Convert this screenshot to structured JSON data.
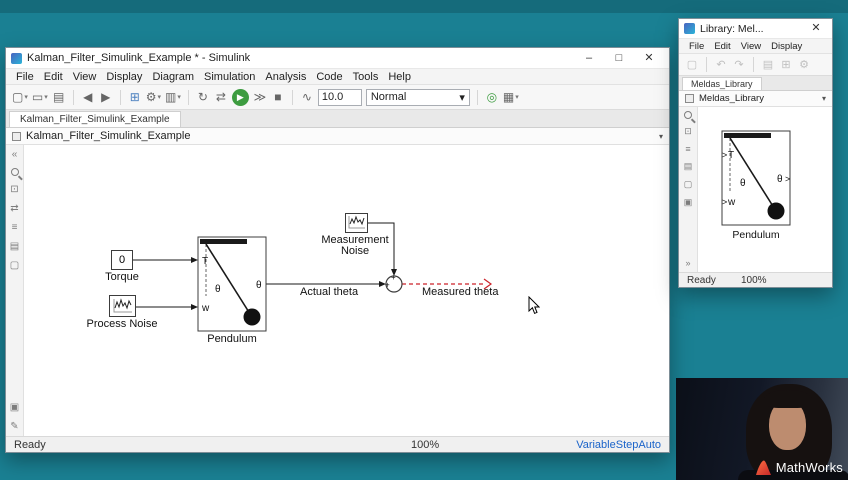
{
  "icons": {
    "caret_down": "▾",
    "new_model": "▢",
    "open": "▭",
    "save": "▤",
    "back": "◀",
    "forward": "▶",
    "library_browser": "⊞",
    "settings": "⚙",
    "model_settings": "▥",
    "refresh": "↻",
    "compare": "⇄",
    "run": "▶",
    "step_forward": "≫",
    "stop": "■",
    "scope": "∿",
    "check": "◎",
    "build": "▦",
    "minimize": "–",
    "maximize": "□",
    "close": "✕",
    "collapse": "«",
    "expand": "»",
    "fit_view": "⊡",
    "list": "≡",
    "layers": "▤",
    "blank": "▢",
    "edit": "✎",
    "frame": "▣",
    "undo": "↶",
    "redo": "↷"
  },
  "main_window": {
    "title": "Kalman_Filter_Simulink_Example * - Simulink",
    "menus": [
      "File",
      "Edit",
      "View",
      "Display",
      "Diagram",
      "Simulation",
      "Analysis",
      "Code",
      "Tools",
      "Help"
    ],
    "toolbar": {
      "sim_stop_time": "10.0",
      "sim_mode": "Normal"
    },
    "tab_label": "Kalman_Filter_Simulink_Example",
    "breadcrumb": "Kalman_Filter_Simulink_Example",
    "status": {
      "left": "Ready",
      "zoom": "100%",
      "solver": "VariableStepAuto"
    },
    "canvas": {
      "torque_value": "0",
      "torque_label": "Torque",
      "process_noise_label": "Process Noise",
      "pendulum_label": "Pendulum",
      "port_T": "T",
      "port_w": "w",
      "port_theta": "θ",
      "theta_symbol": "θ",
      "measurement_noise_label1": "Measurement",
      "measurement_noise_label2": "Noise",
      "sum_plus": "+",
      "actual_theta_label": "Actual theta",
      "measured_theta_label": "Measured theta"
    }
  },
  "library_window": {
    "title": "Library: Mel...",
    "menus": [
      "File",
      "Edit",
      "View",
      "Display"
    ],
    "tab_label": "Meldas_Library",
    "breadcrumb": "Meldas_Library",
    "status": {
      "left": "Ready",
      "zoom": "100%"
    },
    "canvas": {
      "pendulum_label": "Pendulum",
      "port_T": "T",
      "port_w": "w",
      "port_theta": "θ",
      "theta_symbol": "θ",
      "chevron": ">"
    }
  },
  "branding": {
    "logo_text": "MathWorks"
  }
}
